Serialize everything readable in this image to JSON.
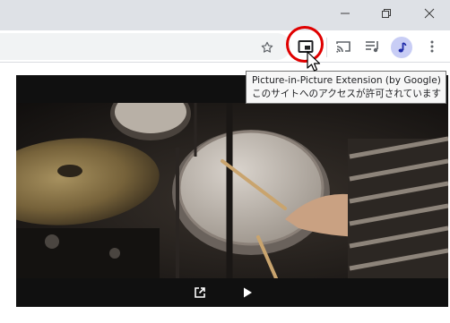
{
  "window_controls": {
    "minimize": "minimize-icon",
    "maximize": "restore-icon",
    "close": "close-icon"
  },
  "toolbar": {
    "bookmark_icon": "star-icon",
    "pip_icon": "picture-in-picture-icon",
    "cast_icon": "cast-icon",
    "media_icon": "media-queue-icon",
    "avatar_icon": "profile-avatar-music-note",
    "menu_icon": "kebab-menu-icon",
    "highlight_color": "#e00000"
  },
  "tooltip": {
    "line1": "Picture-in-Picture Extension (by Google)",
    "line2": "このサイトへのアクセスが許可されています"
  },
  "player": {
    "open_icon": "open-in-new-icon",
    "play_icon": "play-icon"
  }
}
